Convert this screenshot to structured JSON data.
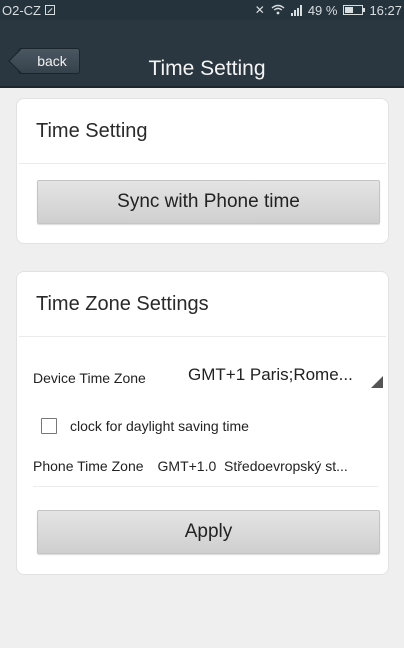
{
  "status_bar": {
    "carrier": "O2-CZ",
    "battery_percent": "49 %",
    "battery_level": 0.49,
    "time": "16:27",
    "icons": [
      "sim-icon",
      "mute-icon",
      "wifi-icon",
      "signal-icon",
      "battery-icon"
    ]
  },
  "navbar": {
    "back_label": "back",
    "title": "Time Setting"
  },
  "time_card": {
    "title": "Time Setting",
    "sync_button": "Sync with Phone time"
  },
  "zone_card": {
    "title": "Time Zone Settings",
    "device_tz_label": "Device Time Zone",
    "device_tz_value": "GMT+1 Paris;Rome...",
    "dst_label": "clock for daylight saving time",
    "dst_checked": false,
    "phone_tz_label": "Phone Time Zone",
    "phone_tz_value": "GMT+1.0  Středoevropský st...",
    "apply_button": "Apply"
  }
}
